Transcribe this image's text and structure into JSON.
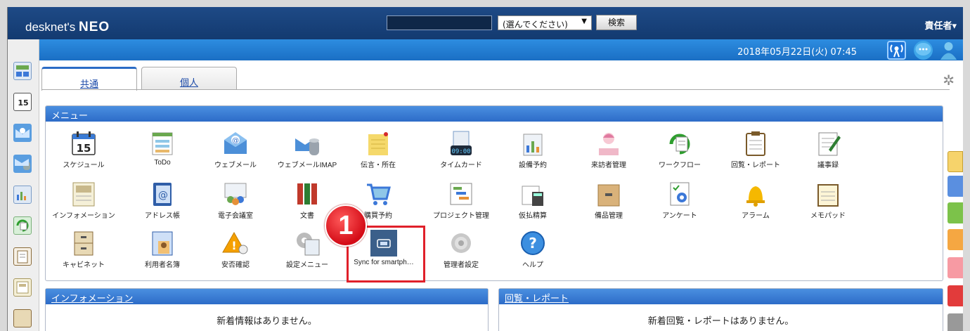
{
  "header": {
    "logo_text": "desknet's",
    "logo_neo": "NEO",
    "search_placeholder": "",
    "select_value": "(選んでください)",
    "search_button": "検索",
    "user_menu": "責任者▾",
    "datetime": "2018年05月22日(火) 07:45"
  },
  "tabs": [
    {
      "label": "共通",
      "active": true
    },
    {
      "label": "個人",
      "active": false
    }
  ],
  "menu": {
    "title": "メニュー",
    "apps": [
      {
        "label": "スケジュール",
        "icon": "calendar-icon"
      },
      {
        "label": "ToDo",
        "icon": "todo-icon"
      },
      {
        "label": "ウェブメール",
        "icon": "webmail-icon"
      },
      {
        "label": "ウェブメールIMAP",
        "icon": "webmail-imap-icon"
      },
      {
        "label": "伝言・所在",
        "icon": "memo-icon"
      },
      {
        "label": "タイムカード",
        "icon": "timecard-icon"
      },
      {
        "label": "設備予約",
        "icon": "facility-icon"
      },
      {
        "label": "来訪者管理",
        "icon": "visitor-icon"
      },
      {
        "label": "ワークフロー",
        "icon": "workflow-icon"
      },
      {
        "label": "回覧・レポート",
        "icon": "clipboard-icon"
      },
      {
        "label": "議事録",
        "icon": "minutes-icon"
      },
      {
        "label": "インフォメーション",
        "icon": "information-icon"
      },
      {
        "label": "アドレス帳",
        "icon": "address-book-icon"
      },
      {
        "label": "電子会議室",
        "icon": "conference-icon"
      },
      {
        "label": "文書",
        "icon": "document-icon"
      },
      {
        "label": "購買予約",
        "icon": "cart-icon"
      },
      {
        "label": "プロジェクト管理",
        "icon": "project-icon"
      },
      {
        "label": "仮払精算",
        "icon": "expense-icon"
      },
      {
        "label": "備品管理",
        "icon": "box-icon"
      },
      {
        "label": "アンケート",
        "icon": "survey-icon"
      },
      {
        "label": "アラーム",
        "icon": "bell-icon"
      },
      {
        "label": "メモパッド",
        "icon": "memopad-icon"
      },
      {
        "label": "キャビネット",
        "icon": "cabinet-icon"
      },
      {
        "label": "利用者名簿",
        "icon": "user-directory-icon"
      },
      {
        "label": "安否確認",
        "icon": "safety-icon"
      },
      {
        "label": "設定メニュー",
        "icon": "settings-menu-icon"
      },
      {
        "label": "Sync for smartph…",
        "icon": "sync-icon"
      },
      {
        "label": "管理者設定",
        "icon": "admin-gear-icon"
      },
      {
        "label": "ヘルプ",
        "icon": "help-icon"
      }
    ]
  },
  "callout_number": "1",
  "panels": {
    "information": {
      "title": "インフォメーション",
      "message": "新着情報はありません。"
    },
    "circular": {
      "title": "回覧・レポート",
      "message": "新着回覧・レポートはありません。"
    }
  },
  "colors": {
    "header_dark": "#1e4a86",
    "subbar_blue": "#2d8de0",
    "panel_header": "#2d6cc8",
    "highlight_red": "#e0202a"
  }
}
